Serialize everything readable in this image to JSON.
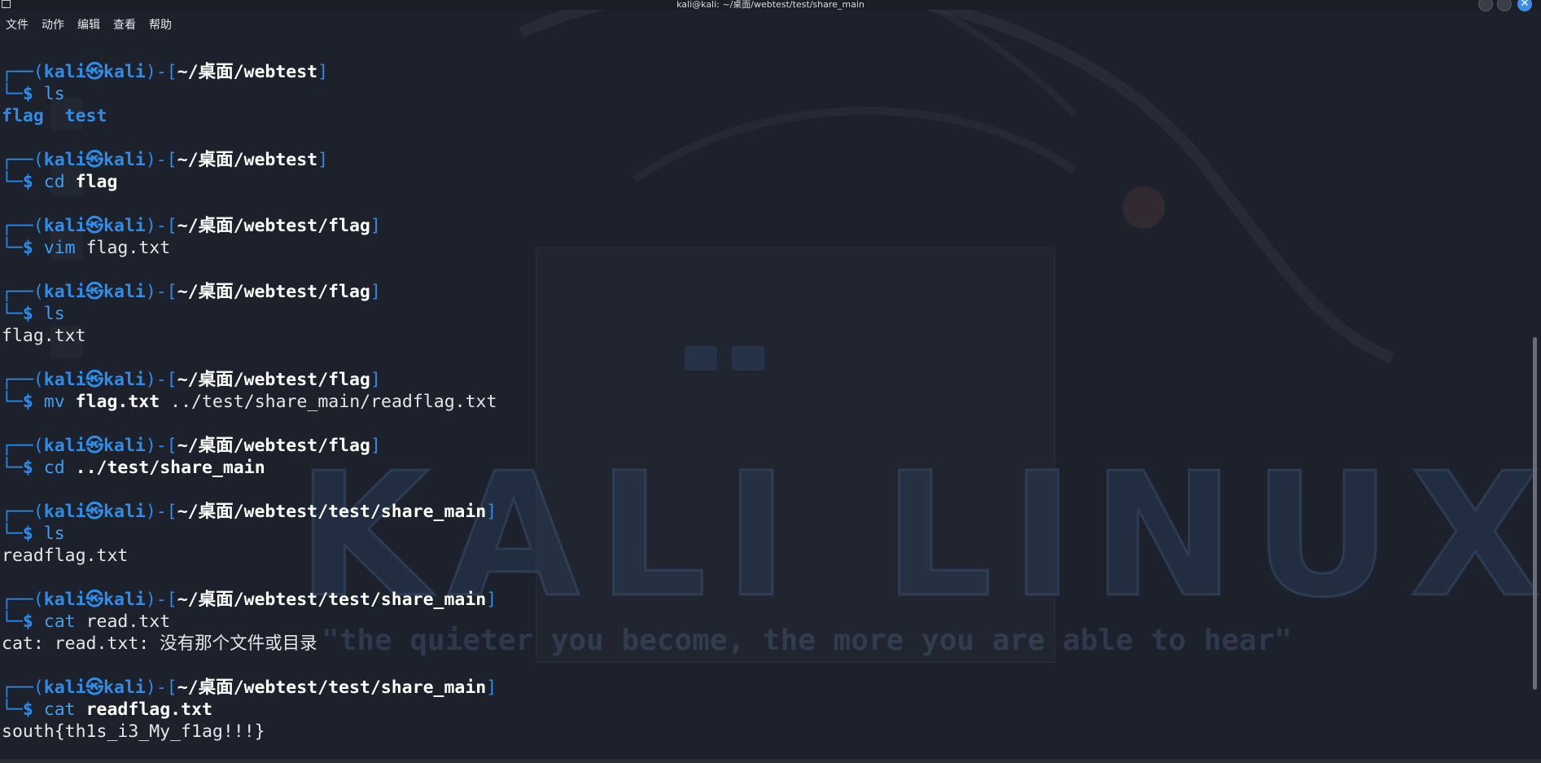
{
  "window": {
    "title": "kali@kali: ~/桌面/webtest/test/share_main",
    "icon_name": "terminal-icon",
    "buttons": [
      "minimize-button",
      "maximize-button",
      "close-button"
    ],
    "close_glyph": "✕"
  },
  "menu": {
    "items": [
      "文件",
      "动作",
      "编辑",
      "查看",
      "帮助"
    ]
  },
  "theme": {
    "background": "#1d212b",
    "prompt_blue": "#2f8de8",
    "command_blue": "#3ea0f0",
    "text": "#e4e6ea"
  },
  "prompt": {
    "corner_top": "┌──(",
    "user": "kali㉿kali",
    "mid": ")-[",
    "close": "]",
    "corner_bottom": "└─",
    "dollar": "$"
  },
  "blocks": [
    {
      "path": "~/桌面/webtest",
      "cmd": "ls",
      "arg": "",
      "arg_bold": false,
      "output": [
        {
          "type": "dirs",
          "items": [
            "flag",
            "test"
          ]
        }
      ]
    },
    {
      "path": "~/桌面/webtest",
      "cmd": "cd",
      "arg": "flag",
      "arg_bold": true,
      "output": []
    },
    {
      "path": "~/桌面/webtest/flag",
      "cmd": "vim",
      "arg": "flag.txt",
      "arg_bold": false,
      "output": []
    },
    {
      "path": "~/桌面/webtest/flag",
      "cmd": "ls",
      "arg": "",
      "arg_bold": false,
      "output": [
        {
          "type": "text",
          "text": "flag.txt"
        }
      ]
    },
    {
      "path": "~/桌面/webtest/flag",
      "cmd": "mv",
      "arg_parts": [
        {
          "text": "flag.txt",
          "bold": true
        },
        {
          "text": " ../test/share_main/readflag.txt",
          "bold": false
        }
      ],
      "output": []
    },
    {
      "path": "~/桌面/webtest/flag",
      "cmd": "cd",
      "arg": "../test/share_main",
      "arg_bold": true,
      "output": []
    },
    {
      "path": "~/桌面/webtest/test/share_main",
      "cmd": "ls",
      "arg": "",
      "arg_bold": false,
      "output": [
        {
          "type": "text",
          "text": "readflag.txt"
        }
      ]
    },
    {
      "path": "~/桌面/webtest/test/share_main",
      "cmd": "cat",
      "arg": "read.txt",
      "arg_bold": false,
      "output": [
        {
          "type": "text",
          "text": "cat: read.txt: 没有那个文件或目录"
        }
      ]
    },
    {
      "path": "~/桌面/webtest/test/share_main",
      "cmd": "cat",
      "arg": "readflag.txt",
      "arg_bold": true,
      "output": [
        {
          "type": "text",
          "text": "south{th1s_i3_My_f1ag!!!}"
        }
      ]
    }
  ],
  "desktop_background": {
    "logo_text": "KALI LINUX",
    "quote": "\"the quieter you become, the more you are able to hear\""
  }
}
